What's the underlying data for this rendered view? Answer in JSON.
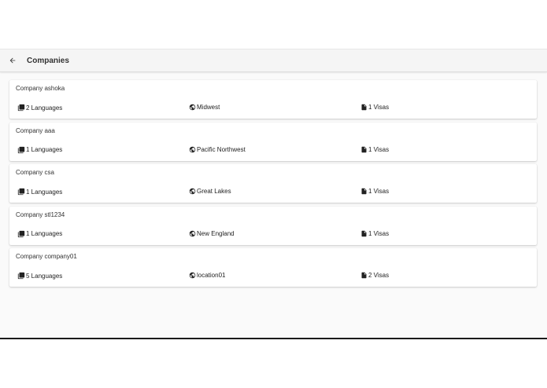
{
  "header": {
    "title": "Companies",
    "back_icon": "arrow-back-icon"
  },
  "companies": [
    {
      "name": "Company ashoka",
      "languages": "2 Languages",
      "location": "Midwest",
      "visas": "1 Visas"
    },
    {
      "name": "Company aaa",
      "languages": "1 Languages",
      "location": "Pacific Northwest",
      "visas": "1 Visas"
    },
    {
      "name": "Company csa",
      "languages": "1 Languages",
      "location": "Great Lakes",
      "visas": "1 Visas"
    },
    {
      "name": "Company stl1234",
      "languages": "1 Languages",
      "location": "New England",
      "visas": "1 Visas"
    },
    {
      "name": "Company company01",
      "languages": "5 Languages",
      "location": "location01",
      "visas": "2 Visas"
    }
  ],
  "icons": {
    "languages": "library-books-icon",
    "location": "globe-icon",
    "visas": "document-icon"
  },
  "colors": {
    "toolbar_bg": "#f5f5f5",
    "card_bg": "#ffffff",
    "text": "#212121"
  }
}
